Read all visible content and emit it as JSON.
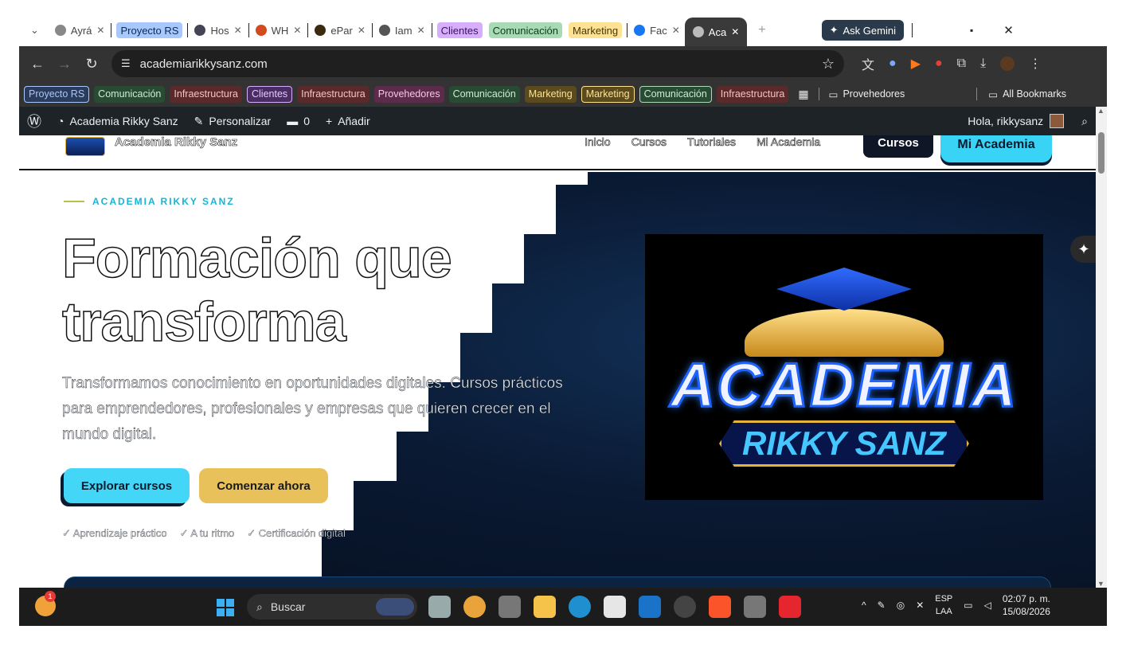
{
  "browser": {
    "tabs": [
      {
        "label": "Ayrá"
      },
      {
        "label": "Hos"
      },
      {
        "label": "WH"
      },
      {
        "label": "ePar"
      },
      {
        "label": "Iam"
      },
      {
        "label": "Fac"
      },
      {
        "label": "Aca"
      }
    ],
    "tab_groups": [
      {
        "label": "Proyecto RS",
        "color": "#a8c7fa"
      },
      {
        "label": "Clientes",
        "color": "#d7aefb"
      },
      {
        "label": "Comunicación",
        "color": "#a8dab5"
      },
      {
        "label": "Marketing",
        "color": "#fde293"
      }
    ],
    "gemini_label": "Ask Gemini",
    "url": "academiarikkysanz.com",
    "bookmarks": [
      {
        "label": "Proyecto RS",
        "bg": "#2a3b5c",
        "fg": "#a8c7fa"
      },
      {
        "label": "Comunicación",
        "bg": "#294a33",
        "fg": "#c9f0d3"
      },
      {
        "label": "Infraestructura",
        "bg": "#5a2a2a",
        "fg": "#f6c1c1"
      },
      {
        "label": "Clientes",
        "bg": "#4a2e63",
        "fg": "#e5c8ff"
      },
      {
        "label": "Infraestructura",
        "bg": "#5a2a2a",
        "fg": "#f6c1c1"
      },
      {
        "label": "Provehedores",
        "bg": "#5c2a4a",
        "fg": "#f7c6e6"
      },
      {
        "label": "Comunicación",
        "bg": "#294a33",
        "fg": "#c9f0d3"
      },
      {
        "label": "Marketing",
        "bg": "#5a4a1c",
        "fg": "#fde293"
      },
      {
        "label": "Marketing",
        "bg": "#5a4a1c",
        "fg": "#fde293"
      },
      {
        "label": "Comunicación",
        "bg": "#294a33",
        "fg": "#c9f0d3"
      },
      {
        "label": "Infraestructura",
        "bg": "#5a2a2a",
        "fg": "#f6c1c1"
      }
    ],
    "folder_provehedores": "Provehedores",
    "all_bookmarks": "All Bookmarks"
  },
  "wp_admin": {
    "site": "Academia Rikky Sanz",
    "customize": "Personalizar",
    "comments": "0",
    "add": "Añadir",
    "greeting": "Hola, rikkysanz"
  },
  "site": {
    "name": "Academia Rikky Sanz",
    "nav": [
      "Inicio",
      "Cursos",
      "Tutoriales",
      "Mi Academia"
    ],
    "btn_cursos": "Cursos",
    "btn_mi_academia": "Mi Academia",
    "eyebrow": "ACADEMIA RIKKY SANZ",
    "headline": "Formación que transforma",
    "lead": "Transformamos conocimiento en oportunidades digitales. Cursos prácticos para emprendedores, profesionales y empresas que quieren crecer en el mundo digital.",
    "btn_explorar": "Explorar cursos",
    "btn_comenzar": "Comenzar ahora",
    "checks": [
      "✓ Aprendizaje práctico",
      "✓ A tu ritmo",
      "✓ Certificación digital"
    ],
    "logo_word": "ACADEMIA",
    "logo_sub": "RIKKY SANZ"
  },
  "taskbar": {
    "search_placeholder": "Buscar",
    "weather_badge": "1",
    "lang_top": "ESP",
    "lang_bottom": "LAA",
    "time": "02:07 p. m.",
    "date": "15/08/2026"
  }
}
